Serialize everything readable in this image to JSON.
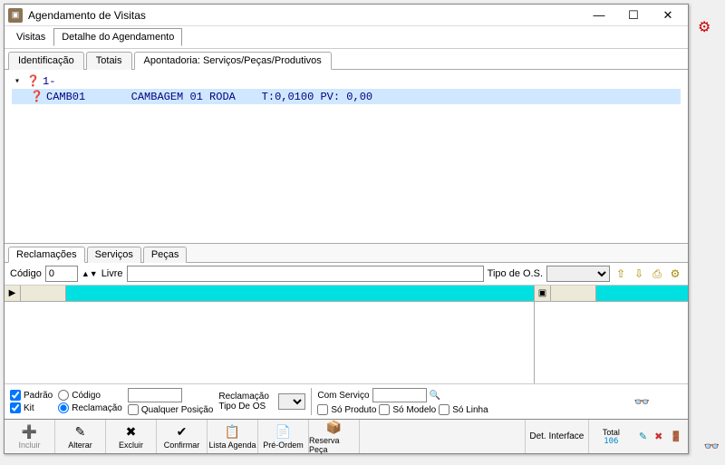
{
  "window": {
    "title": "Agendamento de Visitas"
  },
  "menubar": {
    "items": [
      "Visitas",
      "Detalhe do Agendamento"
    ]
  },
  "tabs": {
    "items": [
      "Identificação",
      "Totais",
      "Apontadoria: Serviços/Peças/Produtivos"
    ]
  },
  "tree": {
    "root": "1-",
    "child_code": "CAMB01",
    "child_desc": "CAMBAGEM 01 RODA",
    "child_meta": "T:0,0100 PV: 0,00"
  },
  "subtabs": {
    "items": [
      "Reclamações",
      "Serviços",
      "Peças"
    ]
  },
  "filter": {
    "codigo_label": "Código",
    "codigo_value": "0",
    "livre_label": "Livre",
    "tipo_label": "Tipo de O.S."
  },
  "options": {
    "padrao": "Padrão",
    "kit": "Kit",
    "codigo": "Código",
    "reclamacao": "Reclamação",
    "qualquer_pos": "Qualquer Posição",
    "rec_tipo": "Reclamação Tipo De OS",
    "com_servico": "Com Serviço",
    "so_produto": "Só Produto",
    "so_modelo": "Só Modelo",
    "so_linha": "Só Linha"
  },
  "actions": {
    "incluir": "Incluir",
    "alterar": "Alterar",
    "excluir": "Excluir",
    "confirmar": "Confirmar",
    "lista_agenda": "Lista Agenda",
    "pre_ordem": "Pré-Ordem",
    "reserva_peca": "Reserva Peça",
    "det_interface": "Det. Interface",
    "total_label": "Total",
    "total_value": "106"
  }
}
